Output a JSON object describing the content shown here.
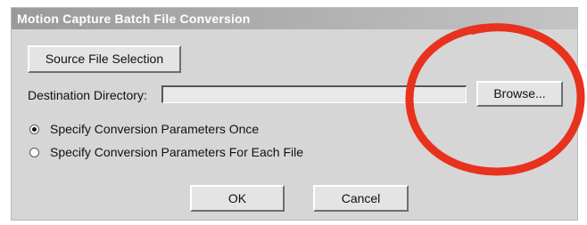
{
  "window": {
    "title": "Motion Capture Batch File Conversion"
  },
  "source_button": {
    "label": "Source File Selection"
  },
  "destination": {
    "label": "Destination Directory:",
    "value": "",
    "browse_label": "Browse..."
  },
  "options": [
    {
      "label": "Specify Conversion Parameters Once",
      "selected": true
    },
    {
      "label": "Specify Conversion Parameters For Each File",
      "selected": false
    }
  ],
  "buttons": {
    "ok_label": "OK",
    "cancel_label": "Cancel"
  },
  "colors": {
    "annotation_circle": "#e8321e",
    "dialog_background": "#d6d6d6"
  },
  "icons": {
    "annotation": "red-circle-annotation"
  }
}
